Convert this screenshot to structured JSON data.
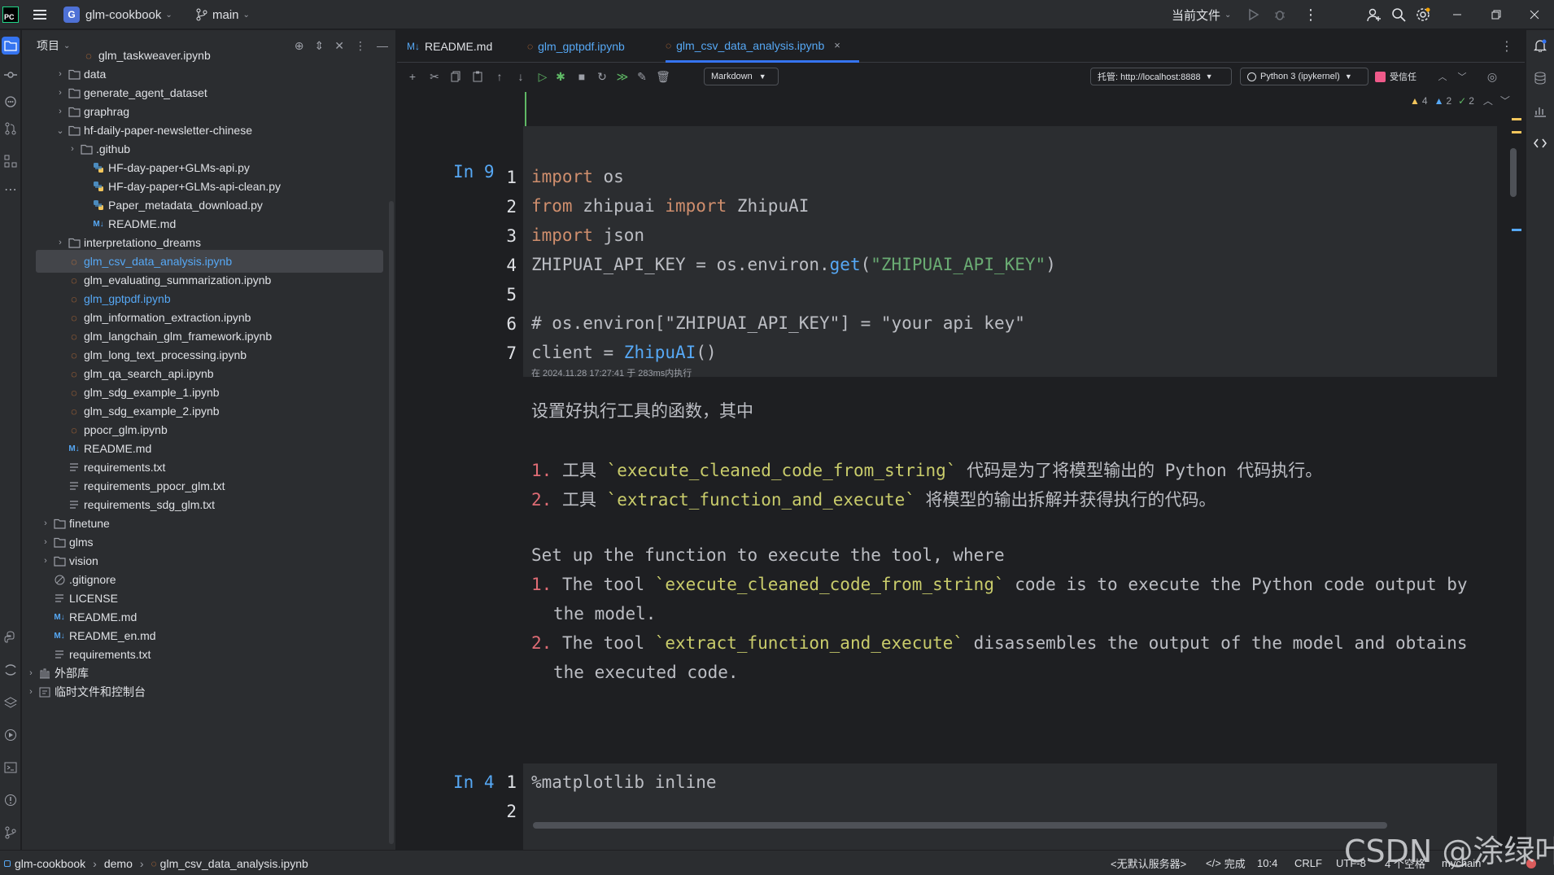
{
  "titlebar": {
    "project": "glm-cookbook",
    "project_initial": "G",
    "branch": "main",
    "run_config": "当前文件"
  },
  "project_panel": {
    "title": "项目",
    "items": [
      {
        "label": "glm_taskweaver.ipynb",
        "type": "ipynb"
      },
      {
        "label": "data",
        "type": "folder"
      },
      {
        "label": "generate_agent_dataset",
        "type": "folder"
      },
      {
        "label": "graphrag",
        "type": "folder"
      },
      {
        "label": "hf-daily-paper-newsletter-chinese",
        "type": "folder-open"
      },
      {
        "label": ".github",
        "type": "folder"
      },
      {
        "label": "HF-day-paper+GLMs-api.py",
        "type": "py"
      },
      {
        "label": "HF-day-paper+GLMs-api-clean.py",
        "type": "py"
      },
      {
        "label": "Paper_metadata_download.py",
        "type": "py"
      },
      {
        "label": "README.md",
        "type": "md"
      },
      {
        "label": "interpretationo_dreams",
        "type": "folder"
      },
      {
        "label": "glm_csv_data_analysis.ipynb",
        "type": "ipynb"
      },
      {
        "label": "glm_evaluating_summarization.ipynb",
        "type": "ipynb"
      },
      {
        "label": "glm_gptpdf.ipynb",
        "type": "ipynb"
      },
      {
        "label": "glm_information_extraction.ipynb",
        "type": "ipynb"
      },
      {
        "label": "glm_langchain_glm_framework.ipynb",
        "type": "ipynb"
      },
      {
        "label": "glm_long_text_processing.ipynb",
        "type": "ipynb"
      },
      {
        "label": "glm_qa_search_api.ipynb",
        "type": "ipynb"
      },
      {
        "label": "glm_sdg_example_1.ipynb",
        "type": "ipynb"
      },
      {
        "label": "glm_sdg_example_2.ipynb",
        "type": "ipynb"
      },
      {
        "label": "ppocr_glm.ipynb",
        "type": "ipynb"
      },
      {
        "label": "README.md",
        "type": "md"
      },
      {
        "label": "requirements.txt",
        "type": "txt"
      },
      {
        "label": "requirements_ppocr_glm.txt",
        "type": "txt"
      },
      {
        "label": "requirements_sdg_glm.txt",
        "type": "txt"
      },
      {
        "label": "finetune",
        "type": "folder"
      },
      {
        "label": "glms",
        "type": "folder"
      },
      {
        "label": "vision",
        "type": "folder"
      },
      {
        "label": ".gitignore",
        "type": "ignore"
      },
      {
        "label": "LICENSE",
        "type": "txt"
      },
      {
        "label": "README.md",
        "type": "md"
      },
      {
        "label": "README_en.md",
        "type": "md"
      },
      {
        "label": "requirements.txt",
        "type": "txt"
      },
      {
        "label": "外部库",
        "type": "lib"
      },
      {
        "label": "临时文件和控制台",
        "type": "scratch"
      }
    ]
  },
  "tabs": [
    {
      "label": "README.md",
      "icon": "M↓"
    },
    {
      "label": "glm_gptpdf.ipynb",
      "icon": "ipynb"
    },
    {
      "label": "glm_csv_data_analysis.ipynb",
      "icon": "ipynb"
    }
  ],
  "toolbar": {
    "cell_type": "Markdown",
    "server": "托管: http://localhost:8888",
    "kernel": "Python 3 (ipykernel)",
    "trusted": "受信任"
  },
  "inspections": {
    "warnings": "4",
    "weak": "2",
    "ok": "2"
  },
  "cell1": {
    "label": "In 9",
    "line_numbers": [
      "1",
      "2",
      "3",
      "4",
      "5",
      "6",
      "7"
    ],
    "exec_info": "在 2024.11.28 17:27:41 于 283ms内执行",
    "lines": [
      [
        {
          "t": "import",
          "c": "kw"
        },
        {
          "t": " os",
          "c": "id"
        }
      ],
      [
        {
          "t": "from",
          "c": "kw"
        },
        {
          "t": " zhipuai ",
          "c": "id"
        },
        {
          "t": "import",
          "c": "kw"
        },
        {
          "t": " ZhipuAI",
          "c": "id"
        }
      ],
      [
        {
          "t": "import",
          "c": "kw"
        },
        {
          "t": " json",
          "c": "id"
        }
      ],
      [
        {
          "t": "ZHIPUAI_API_KEY = os.environ.",
          "c": "id"
        },
        {
          "t": "get",
          "c": "fn"
        },
        {
          "t": "(",
          "c": "id"
        },
        {
          "t": "\"ZHIPUAI_API_KEY\"",
          "c": "str"
        },
        {
          "t": ")",
          "c": "id"
        }
      ],
      [],
      [
        {
          "t": "# os.environ[\"ZHIPUAI_API_KEY\"] = \"your api key\"",
          "c": "cm"
        }
      ],
      [
        {
          "t": "client = ",
          "c": "id"
        },
        {
          "t": "ZhipuAI",
          "c": "fn"
        },
        {
          "t": "()",
          "c": "id"
        }
      ]
    ]
  },
  "markdown": {
    "intro_cn": "设置好执行工具的函数，其中",
    "item1_num": "1.",
    "item1_a": " 工具 ",
    "item1_code": "`execute_cleaned_code_from_string`",
    "item1_b": " 代码是为了将模型输出的 Python 代码执行。",
    "item2_num": "2.",
    "item2_a": " 工具 ",
    "item2_code": "`extract_function_and_execute`",
    "item2_b": " 将模型的输出拆解并获得执行的代码。",
    "intro_en": "Set up the function to execute the tool, where",
    "en1_num": "1.",
    "en1_a": " The tool ",
    "en1_code": "`execute_cleaned_code_from_string`",
    "en1_b": " code is to execute the Python code output by",
    "en1_c": "the model.",
    "en2_num": "2.",
    "en2_a": " The tool ",
    "en2_code": "`extract_function_and_execute`",
    "en2_b": " disassembles the output of the model and obtains",
    "en2_c": "the executed code."
  },
  "cell2": {
    "label": "In 4",
    "line_numbers": [
      "1",
      "2"
    ],
    "line1": "%matplotlib inline"
  },
  "statusbar": {
    "crumbs": [
      "glm-cookbook",
      "demo",
      "glm_csv_data_analysis.ipynb"
    ],
    "server": "<无默认服务器>",
    "done": "完成",
    "position": "10:4",
    "line_sep": "CRLF",
    "encoding": "UTF-8",
    "indent": "4 个空格",
    "interpreter": "mychain"
  },
  "watermark": "CSDN @涂绿叶",
  "colors": {
    "accent": "#3574f0",
    "keyword": "#cf8e6d",
    "function": "#56a8f5",
    "string": "#6aab73",
    "list_number": "#e06c75",
    "inline_code": "#c9cc6b"
  }
}
